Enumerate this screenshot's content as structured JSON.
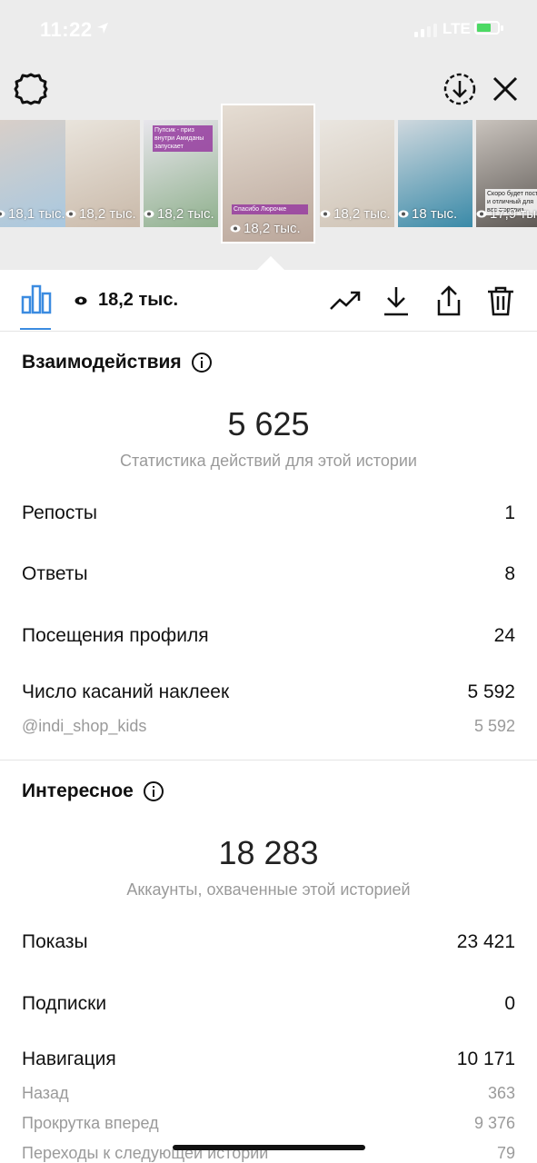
{
  "status": {
    "time": "11:22",
    "network": "LTE"
  },
  "top": {
    "settings_icon": "gear-icon",
    "save_icon": "download-circle-icon",
    "close_icon": "close-icon"
  },
  "thumbnails": [
    {
      "views": "18,1 тыс.",
      "color1": "#d9cfc8",
      "color2": "#a8c8e0"
    },
    {
      "views": "18,2 тыс.",
      "color1": "#e9e4dc",
      "color2": "#c9b9a9"
    },
    {
      "views": "18,2 тыс.",
      "color1": "#e8e6ec",
      "color2": "#8fb08d",
      "tag": "Пупсик - приз внутри Амиданы запускает"
    },
    {
      "views": "18,2 тыс.",
      "color1": "#e5ddd3",
      "color2": "#bba79b",
      "tag": "Спасибо Люрочке"
    },
    {
      "views": "18,2 тыс.",
      "color1": "#eae6e0",
      "color2": "#cfc3b5"
    },
    {
      "views": "18 тыс.",
      "color1": "#cfd8de",
      "color2": "#3a8aa8"
    },
    {
      "views": "17,9 тыс.",
      "color1": "#c9c3bd",
      "color2": "#5b5652",
      "tag": "Скоро будет пост и отличный для вас сюрприз"
    }
  ],
  "toolbar": {
    "views": "18,2 тыс.",
    "icons": [
      "bar-chart-icon",
      "eye-icon",
      "trend-up-icon",
      "download-icon",
      "share-icon",
      "trash-icon"
    ]
  },
  "interactions": {
    "title": "Взаимодействия",
    "total": "5 625",
    "caption": "Статистика действий для этой истории",
    "rows": [
      {
        "label": "Репосты",
        "value": "1"
      },
      {
        "label": "Ответы",
        "value": "8"
      },
      {
        "label": "Посещения профиля",
        "value": "24"
      },
      {
        "label": "Число касаний наклеек",
        "value": "5 592"
      }
    ],
    "sub": {
      "label": "@indi_shop_kids",
      "value": "5 592"
    }
  },
  "discovery": {
    "title": "Интересное",
    "total": "18 283",
    "caption": "Аккаунты, охваченные этой историей",
    "rows": [
      {
        "label": "Показы",
        "value": "23 421"
      },
      {
        "label": "Подписки",
        "value": "0"
      },
      {
        "label": "Навигация",
        "value": "10 171"
      }
    ],
    "subs": [
      {
        "label": "Назад",
        "value": "363"
      },
      {
        "label": "Прокрутка вперед",
        "value": "9 376"
      },
      {
        "label": "Переходы к следующей истории",
        "value": "79"
      }
    ]
  },
  "colors": {
    "accent": "#3b8be0",
    "muted": "#9a9a9a",
    "divider": "#e4e4e4"
  }
}
